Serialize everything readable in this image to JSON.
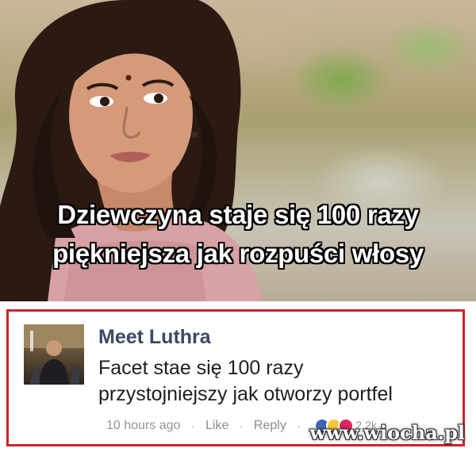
{
  "meme": {
    "caption_line1": "Dziewczyna staje się 100 razy",
    "caption_line2": "piękniejsza jak rozpuści włosy"
  },
  "comment": {
    "author": "Meet Luthra",
    "text_line1": "Facet stae się 100 razy",
    "text_line2": "przystojniejszy jak otworzy portfel",
    "time": "10 hours ago",
    "like_label": "Like",
    "reply_label": "Reply",
    "separator": "·",
    "reaction_count": "2,2k",
    "reactions": [
      "like-icon",
      "haha-icon",
      "love-icon"
    ],
    "border_color": "#c9242a"
  },
  "watermark": "www.wiocha.pl"
}
